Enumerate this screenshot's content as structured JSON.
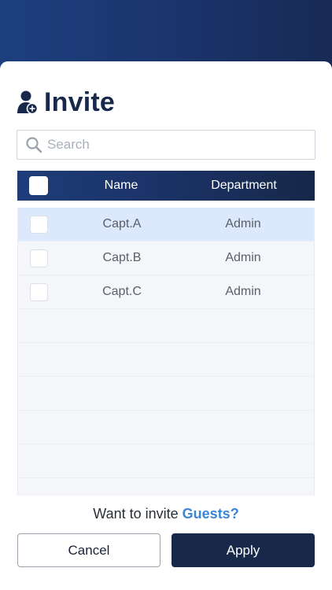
{
  "header": {
    "title": "Invite"
  },
  "search": {
    "placeholder": "Search",
    "value": ""
  },
  "table": {
    "columns": [
      "Name",
      "Department"
    ],
    "rows": [
      {
        "name": "Capt.A",
        "department": "Admin",
        "selected": true
      },
      {
        "name": "Capt.B",
        "department": "Admin",
        "selected": false
      },
      {
        "name": "Capt.C",
        "department": "Admin",
        "selected": false
      }
    ]
  },
  "guests": {
    "prompt": "Want to invite ",
    "link": "Guests?"
  },
  "actions": {
    "cancel": "Cancel",
    "apply": "Apply"
  },
  "colors": {
    "navy": "#17284a",
    "accent": "#3b86d6",
    "selected_row": "#dce8fb"
  }
}
